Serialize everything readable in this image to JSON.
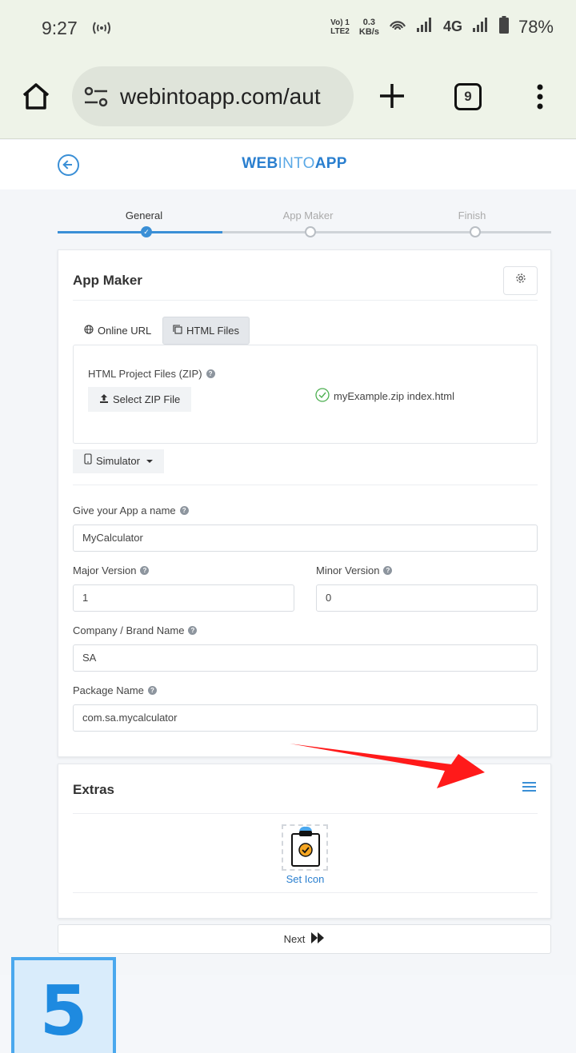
{
  "status_bar": {
    "time": "9:27",
    "volte_top": "Vo) 1",
    "volte_bottom": "LTE2",
    "speed_value": "0.3",
    "speed_unit": "KB/s",
    "network": "4G",
    "battery": "78%"
  },
  "browser": {
    "url": "webintoapp.com/aut",
    "tab_count": "9"
  },
  "header": {
    "brand_part1": "WEB",
    "brand_part2": "INTO",
    "brand_part3": "APP"
  },
  "stepper": {
    "steps": [
      {
        "label": "General",
        "state": "done"
      },
      {
        "label": "App Maker",
        "state": "pending"
      },
      {
        "label": "Finish",
        "state": "pending"
      }
    ]
  },
  "app_maker": {
    "title": "App Maker",
    "tabs": [
      {
        "label": "Online URL",
        "active": false
      },
      {
        "label": "HTML Files",
        "active": true
      }
    ],
    "zip_label": "HTML Project Files (ZIP)",
    "zip_button": "Select ZIP File",
    "file_status": "myExample.zip index.html",
    "simulator_button": "Simulator",
    "fields": {
      "app_name": {
        "label": "Give your App a name",
        "value": "MyCalculator"
      },
      "major_version": {
        "label": "Major Version",
        "value": "1"
      },
      "minor_version": {
        "label": "Minor Version",
        "value": "0"
      },
      "company": {
        "label": "Company / Brand Name",
        "value": "SA"
      },
      "package": {
        "label": "Package Name",
        "value": "com.sa.mycalculator"
      }
    }
  },
  "extras": {
    "title": "Extras",
    "set_icon_label": "Set Icon"
  },
  "next_button": "Next",
  "annotation": {
    "step_number": "5",
    "arrow_color": "#ff1a1a"
  },
  "colors": {
    "accent": "#3a8fd6",
    "success": "#4caf50",
    "badge_bg": "#d9ecfb"
  }
}
